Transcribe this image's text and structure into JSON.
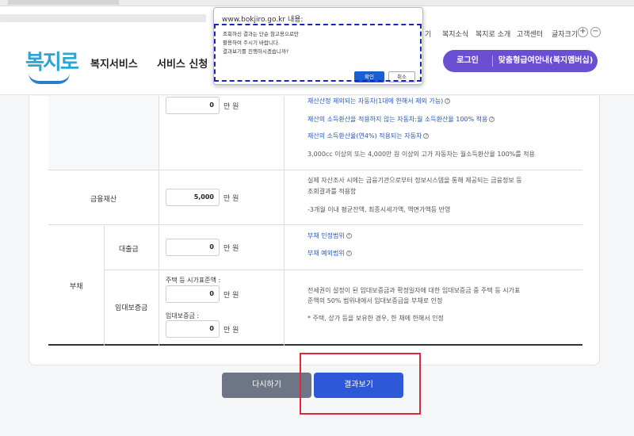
{
  "header": {
    "logo": "복지로",
    "nav": [
      "복지서비스",
      "서비스 신청"
    ],
    "utils": [
      "기",
      "복지소식",
      "복지로 소개",
      "고객센터",
      "글자크기"
    ],
    "zoom_in": "+",
    "zoom_out": "−",
    "login": "로그인",
    "guide": "맞춤형급여안내(복지멤버십)"
  },
  "dialog": {
    "title": "www.bokjiro.go.kr 내용:",
    "lines": [
      "조회하신 결과는 단순 참고용으로만",
      "활용하여 주시기 바랍니다.",
      "결과보기를 진행하시겠습니까?"
    ],
    "ok": "확인",
    "cancel": "취소"
  },
  "table": {
    "top_row": {
      "value": "0",
      "unit": "만 원",
      "notes": [
        "재산산정 제외되는 자동차(1대에 한해서 제외 가능)",
        "재산의 소득환산을 적용하지 않는 자동차:월 소득환산율 100% 적용",
        "재산의 소득환산율(연4%) 적용되는 자동차",
        "3,000cc 이상의 또는 4,000만 원 이상의 고가 자동차는 월소득환산율 100%를 적용"
      ]
    },
    "financial": {
      "label": "금융재산",
      "value": "5,000",
      "unit": "만 원",
      "notes": [
        "실제 자산조사 시에는 금융기관으로부터 정보시스템을 통해 제공되는 금융정보 등",
        "조회결과를 적용함",
        "-3개월 이내 평균잔액, 최종시세가액, 액면가액등 반영"
      ]
    },
    "debt": {
      "label": "부채",
      "loan": {
        "label": "대출금",
        "value": "0",
        "unit": "만 원",
        "links": [
          "부채 인정범위",
          "부채 예외범위"
        ]
      },
      "deposit": {
        "label": "임대보증금",
        "sub1": "주택 등 시가표준액 :",
        "value1": "0",
        "unit1": "만 원",
        "sub2": "임대보증금 :",
        "value2": "0",
        "unit2": "만 원",
        "notes": [
          "전세권이 설정이 된 임대보증금과 확정일자에 대한 임대보증금 중 주택 등 시가표",
          "준액의 50% 범위내에서 임대보증금을 부채로 인정",
          "* 주택, 상가 등을 보유한 경우, 한 채에 한해서 인정"
        ]
      }
    }
  },
  "buttons": {
    "reset": "다시하기",
    "result": "결과보기"
  },
  "colors": {
    "primary": "#2d59d9",
    "login": "#6a4fd3",
    "highlight_red": "#e0283d",
    "highlight_blue": "#1a22c8"
  }
}
